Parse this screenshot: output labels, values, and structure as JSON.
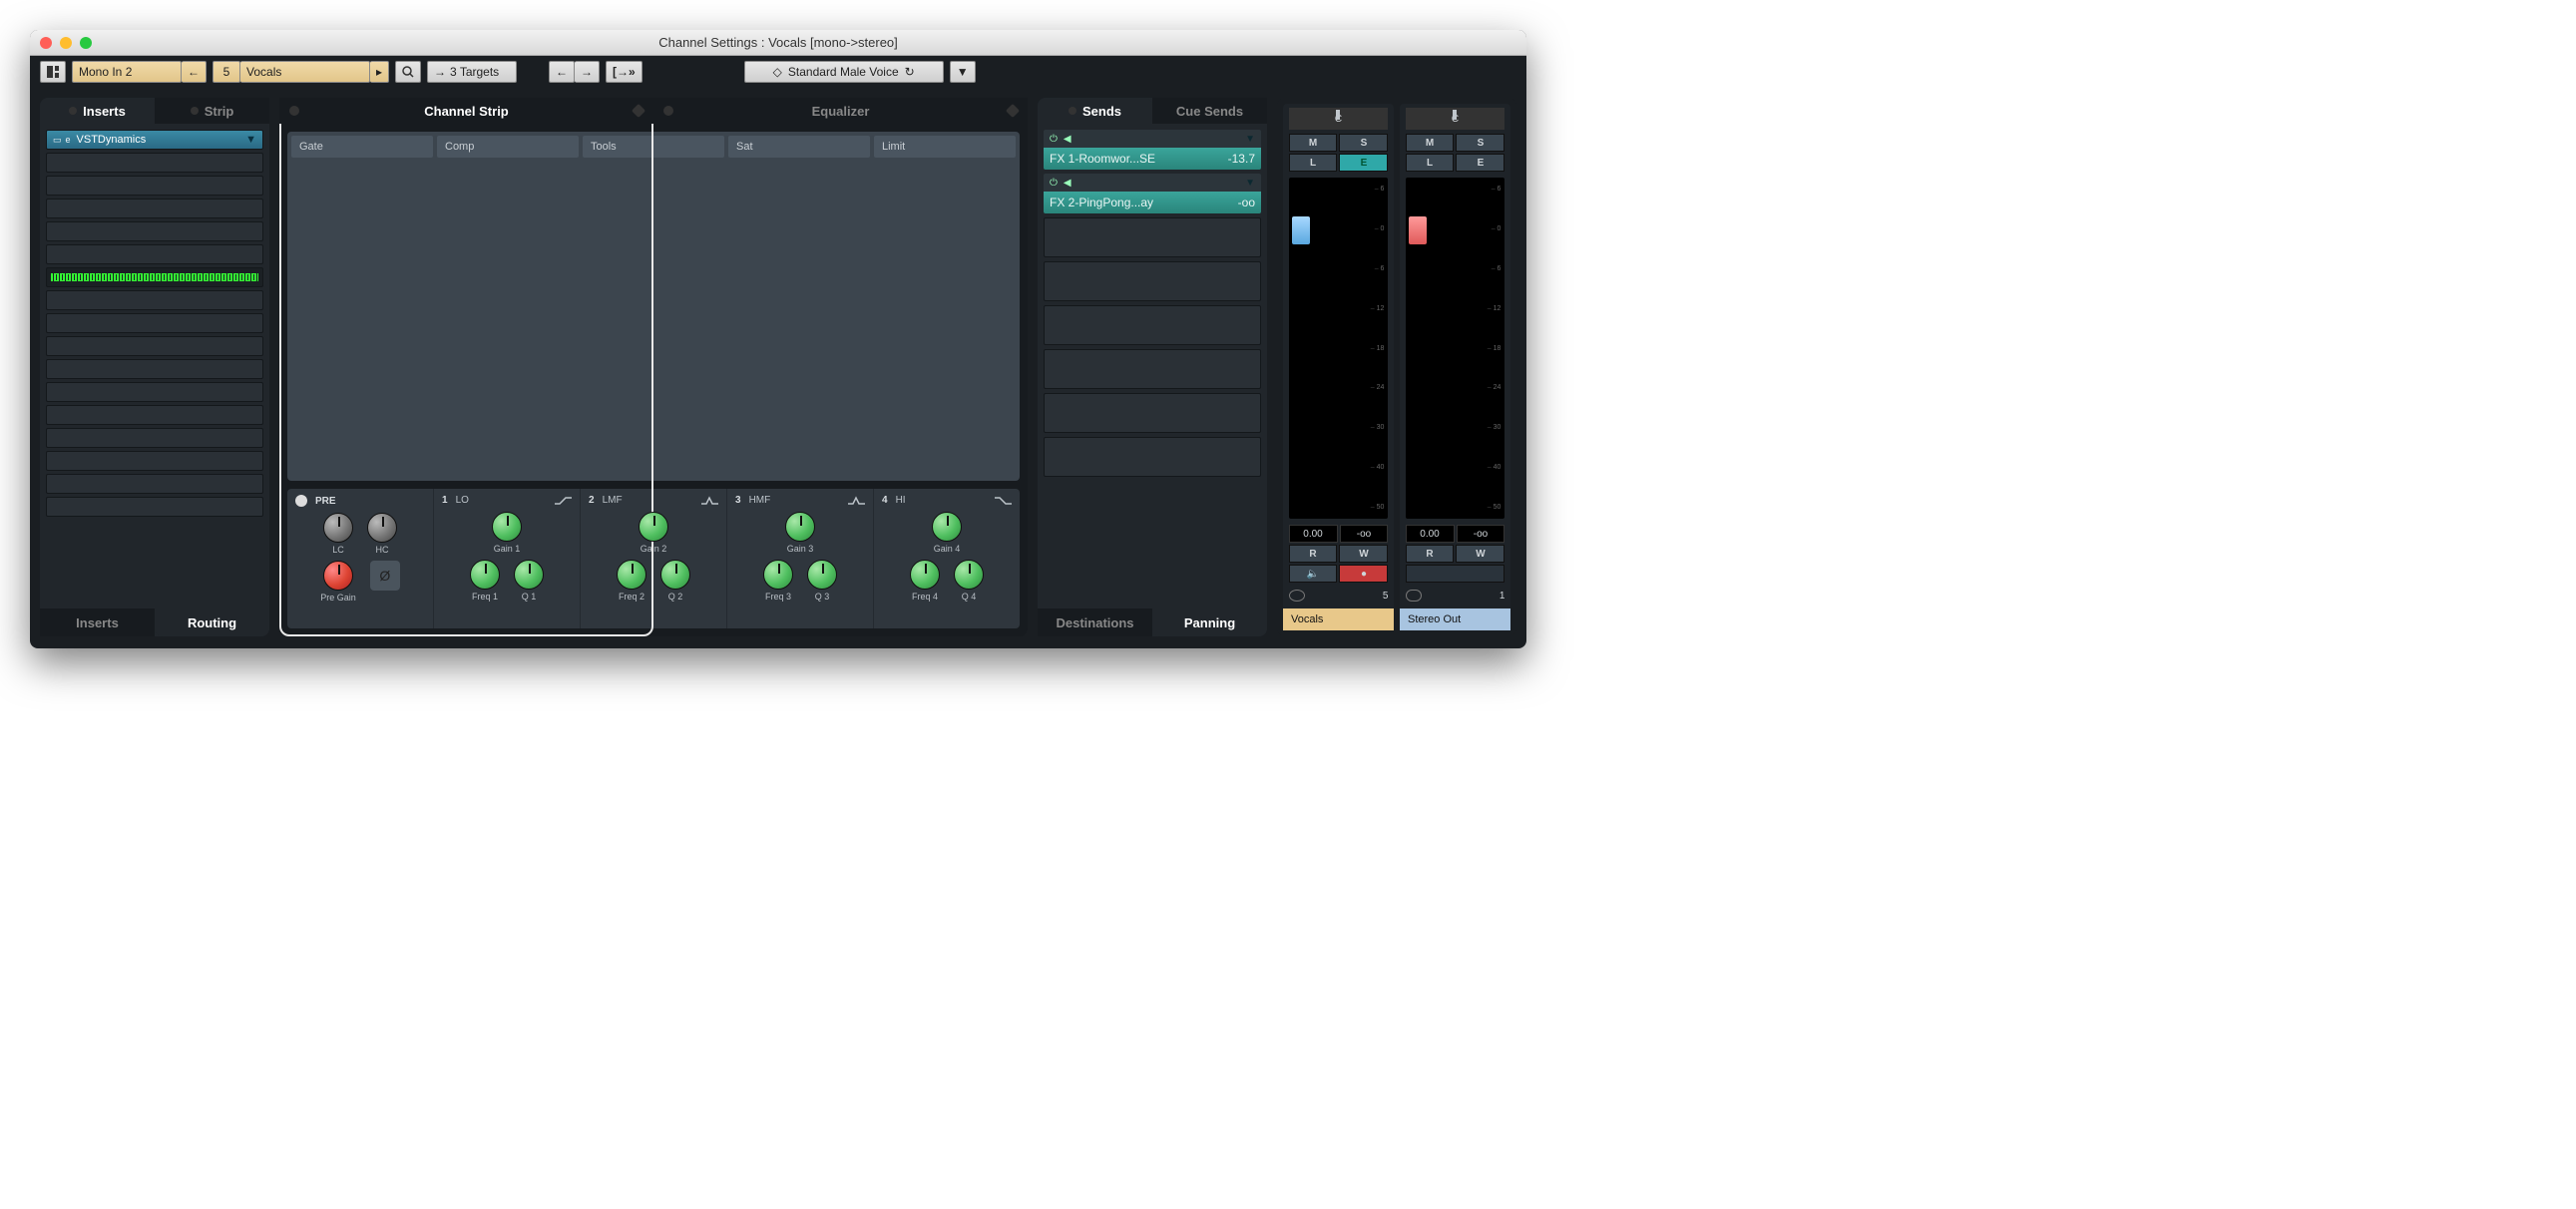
{
  "window_title": "Channel Settings : Vocals [mono->stereo]",
  "toolbar": {
    "input_label": "Mono In 2",
    "ch_number": "5",
    "channel_name": "Vocals",
    "targets_label": "3 Targets",
    "preset_label": "Standard Male Voice"
  },
  "inserts_panel": {
    "tab_inserts": "Inserts",
    "tab_strip": "Strip",
    "slot1": "VSTDynamics",
    "bottom_tab_inserts": "Inserts",
    "bottom_tab_routing": "Routing"
  },
  "center": {
    "tab_strip": "Channel Strip",
    "tab_eq": "Equalizer",
    "strip_cols": {
      "c1": "Gate",
      "c2": "Comp",
      "c3": "Tools",
      "c4": "Sat",
      "c5": "Limit"
    },
    "pre": {
      "label": "PRE",
      "lc": "LC",
      "hc": "HC",
      "pregain": "Pre Gain"
    },
    "bands": {
      "b1": {
        "num": "1",
        "name": "LO",
        "gain": "Gain 1",
        "freq": "Freq 1",
        "q": "Q 1"
      },
      "b2": {
        "num": "2",
        "name": "LMF",
        "gain": "Gain 2",
        "freq": "Freq 2",
        "q": "Q 2"
      },
      "b3": {
        "num": "3",
        "name": "HMF",
        "gain": "Gain 3",
        "freq": "Freq 3",
        "q": "Q 3"
      },
      "b4": {
        "num": "4",
        "name": "HI",
        "gain": "Gain 4",
        "freq": "Freq 4",
        "q": "Q 4"
      }
    }
  },
  "sends_panel": {
    "tab_sends": "Sends",
    "tab_cue": "Cue Sends",
    "send1_name": "FX 1-Roomwor...SE",
    "send1_val": "-13.7",
    "send2_name": "FX 2-PingPong...ay",
    "send2_val": "-oo",
    "bottom_dest": "Destinations",
    "bottom_pan": "Panning"
  },
  "faders": {
    "pan_c": "C",
    "m": "M",
    "s": "S",
    "l": "L",
    "e": "E",
    "scale": [
      "6",
      "0",
      "6",
      "12",
      "18",
      "24",
      "30",
      "40",
      "50"
    ],
    "left_val": "0.00",
    "left_peak": "-oo",
    "right_val": "0.00",
    "right_peak": "-oo",
    "r": "R",
    "w": "W",
    "left_out_count": "5",
    "right_out_count": "1",
    "left_name": "Vocals",
    "right_name": "Stereo Out"
  }
}
